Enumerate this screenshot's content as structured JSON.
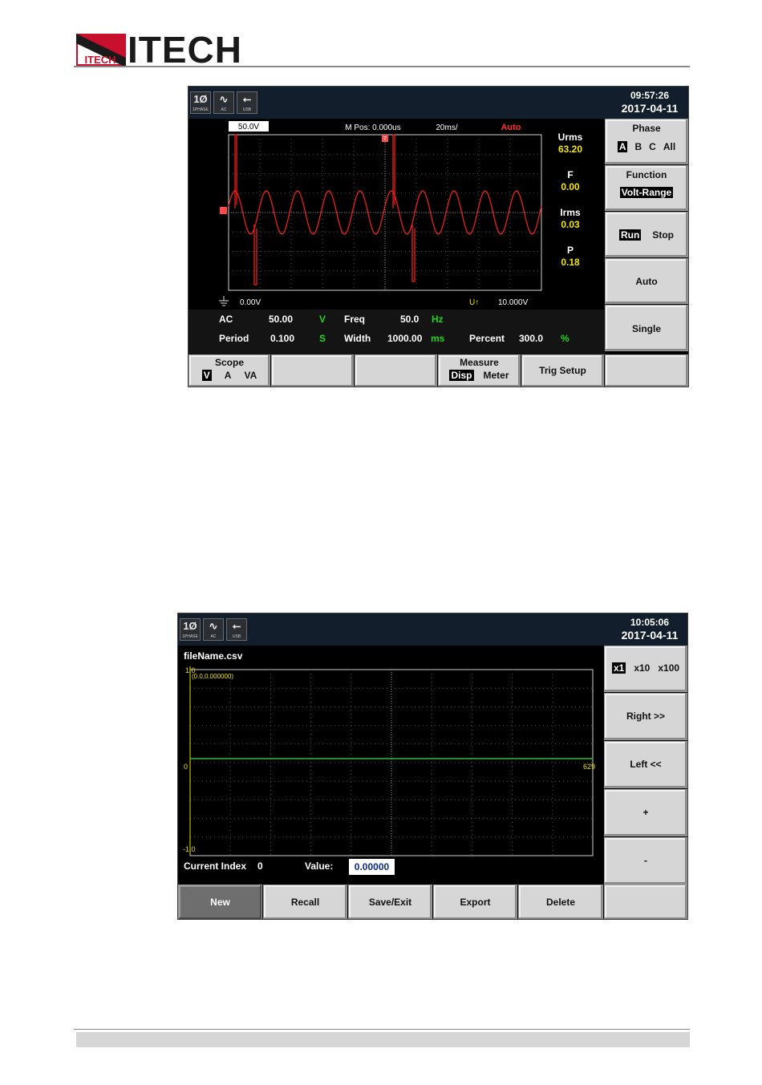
{
  "header": {
    "brand": "ITECH"
  },
  "screen1": {
    "status_icons": [
      {
        "glyph": "1Ø",
        "caption": "1PHASE",
        "icon": "phase-icon"
      },
      {
        "glyph": "∿",
        "caption": "AC",
        "icon": "ac-wave-icon"
      },
      {
        "glyph": "⭠",
        "caption": "USB",
        "icon": "usb-icon"
      }
    ],
    "time": "09:57:26",
    "date": "2017-04-11",
    "scope": {
      "scale_label": "50.0V",
      "mpos": "M Pos: 0.000us",
      "timebase": "20ms/",
      "mode": "Auto",
      "trigger_marker": "T",
      "ground_level": "0.00V",
      "trigger_level_label": "U↑",
      "trigger_level": "10.000V"
    },
    "readouts": [
      {
        "label": "Urms",
        "value": "63.20"
      },
      {
        "label": "F",
        "value": "0.00"
      },
      {
        "label": "Irms",
        "value": "0.03"
      },
      {
        "label": "P",
        "value": "0.18"
      }
    ],
    "measure": {
      "row1": {
        "type": "AC",
        "amp": "50.00",
        "amp_unit": "V",
        "freq_label": "Freq",
        "freq": "50.0",
        "freq_unit": "Hz"
      },
      "row2": {
        "period_label": "Period",
        "period": "0.100",
        "period_unit": "S",
        "width_label": "Width",
        "width": "1000.00",
        "width_unit": "ms",
        "percent_label": "Percent",
        "percent": "300.0",
        "percent_unit": "%"
      }
    },
    "right_keys": {
      "phase": {
        "title": "Phase",
        "options": [
          "A",
          "B",
          "C",
          "All"
        ],
        "selected": "A"
      },
      "function": {
        "title": "Function",
        "value": "Volt-Range"
      },
      "run_stop": {
        "run": "Run",
        "stop": "Stop"
      },
      "auto": "Auto",
      "single": "Single"
    },
    "bottom_keys": {
      "scope": {
        "title": "Scope",
        "options": [
          "V",
          "A",
          "VA"
        ],
        "selected": "V"
      },
      "measure": {
        "title": "Measure",
        "disp": "Disp",
        "meter": "Meter"
      },
      "trig_setup": "Trig Setup"
    }
  },
  "screen2": {
    "status_icons": [
      {
        "glyph": "1Ø",
        "caption": "1PHASE",
        "icon": "phase-icon"
      },
      {
        "glyph": "∿",
        "caption": "AC",
        "icon": "ac-wave-icon"
      },
      {
        "glyph": "⭠",
        "caption": "USB",
        "icon": "usb-icon"
      }
    ],
    "time": "10:05:06",
    "date": "2017-04-11",
    "file_name": "fileName.csv",
    "plot": {
      "y_max": "1.0",
      "y_zero": "0",
      "y_min": "-1.0",
      "x_end": "629",
      "cursor": "(0.0,0.000000)"
    },
    "current_index_label": "Current Index",
    "current_index": "0",
    "value_label": "Value:",
    "value": "0.00000",
    "right_keys": {
      "zoom": {
        "options": [
          "x1",
          "x10",
          "x100"
        ],
        "selected": "x1"
      },
      "right": "Right >>",
      "left": "Left <<",
      "plus": "+",
      "minus": "-"
    },
    "bottom_keys": [
      "New",
      "Recall",
      "Save/Exit",
      "Export",
      "Delete"
    ]
  }
}
